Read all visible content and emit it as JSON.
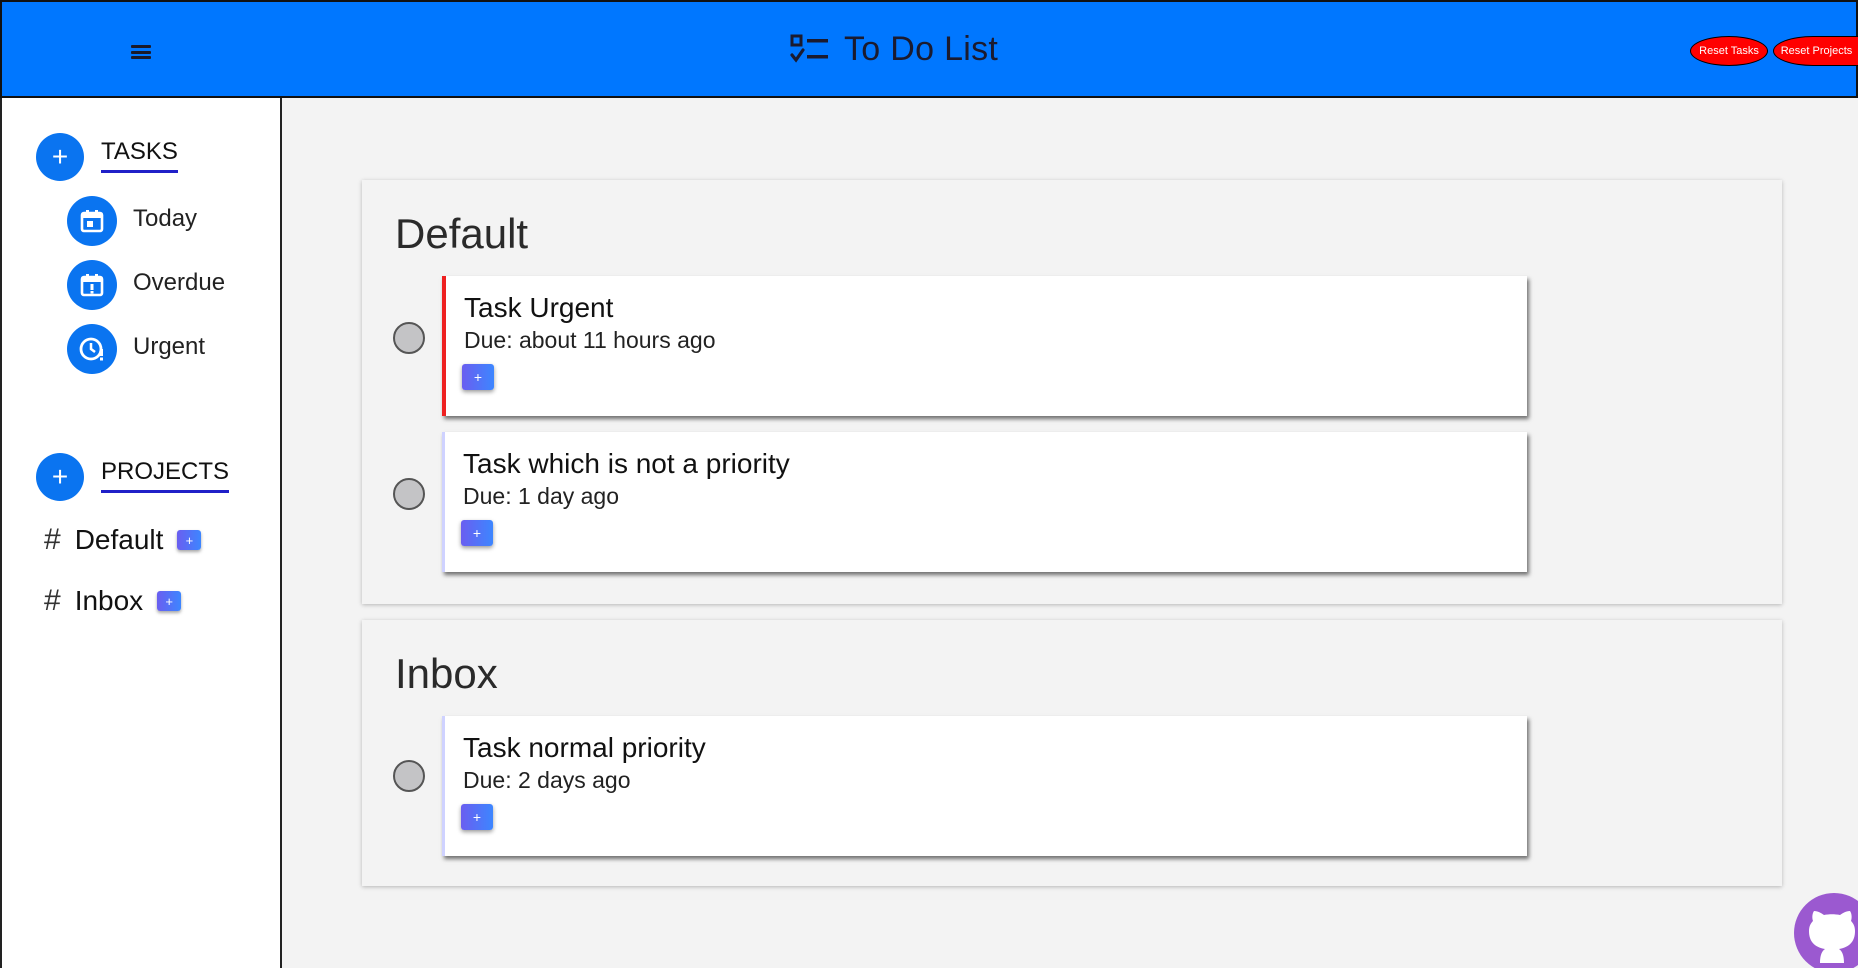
{
  "header": {
    "title": "To Do List",
    "menu_icon": "hamburger-menu-icon",
    "brand_icon": "checklist-icon",
    "reset_tasks_label": "Reset Tasks",
    "reset_projects_label": "Reset Projects",
    "color": "#0077ff"
  },
  "sidebar": {
    "tasks_title": "TASKS",
    "nav": [
      {
        "label": "Today",
        "icon": "calendar-today-icon"
      },
      {
        "label": "Overdue",
        "icon": "calendar-alert-icon"
      },
      {
        "label": "Urgent",
        "icon": "clock-alert-icon"
      }
    ],
    "projects_title": "PROJECTS",
    "projects": [
      {
        "hash": "#",
        "name": "Default",
        "add": "+"
      },
      {
        "hash": "#",
        "name": "Inbox",
        "add": "+"
      }
    ],
    "add_symbol": "+"
  },
  "main": {
    "projects": [
      {
        "title": "Default",
        "tasks": [
          {
            "title": "Task Urgent",
            "due": "Due: about 11 hours ago",
            "add": "+",
            "priority": "urgent"
          },
          {
            "title": "Task which is not a priority",
            "due": "Due: 1 day ago",
            "add": "+",
            "priority": "low"
          }
        ]
      },
      {
        "title": "Inbox",
        "tasks": [
          {
            "title": "Task normal priority",
            "due": "Due: 2 days ago",
            "add": "+",
            "priority": "normal"
          }
        ]
      }
    ]
  },
  "colors": {
    "accent": "#0a74f0",
    "urgent": "#ee2020",
    "reset": "#ff0000",
    "github": "#9b59d0"
  },
  "footer": {
    "github_icon": "github-icon"
  }
}
